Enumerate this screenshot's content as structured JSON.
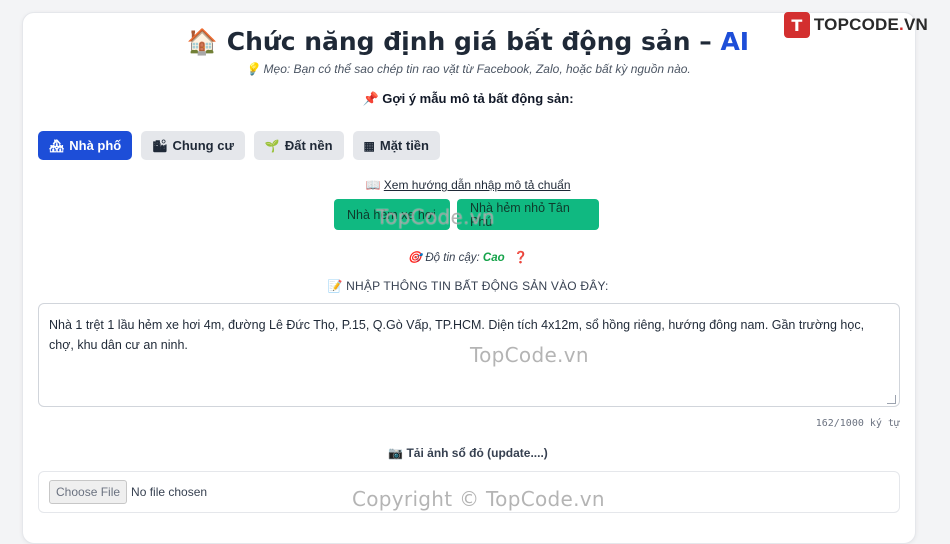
{
  "logo": {
    "mark": "T",
    "text_main": "TOPCODE",
    "text_dot": ".",
    "text_tld": "VN"
  },
  "header": {
    "icon": "🏠",
    "title": "Chức năng định giá bất động sản – ",
    "title_accent": "AI",
    "tip_icon": "💡",
    "tip": "Mẹo: Bạn có thể sao chép tin rao vặt từ Facebook, Zalo, hoặc bất kỳ nguồn nào."
  },
  "suggestions": {
    "icon": "📌",
    "label": "Gợi ý mẫu mô tả bất động sản:",
    "chips": [
      {
        "icon": "🏘",
        "label": "Nhà phố",
        "active": true
      },
      {
        "icon": "🏙",
        "label": "Chung cư",
        "active": false
      },
      {
        "icon": "🌱",
        "label": "Đất nền",
        "active": false
      },
      {
        "icon": "▦",
        "label": "Mặt tiền",
        "active": false
      }
    ]
  },
  "guide": {
    "icon": "📖",
    "link": "Xem hướng dẫn nhập mô tả chuẩn"
  },
  "examples": [
    {
      "label": "Nhà hẻm xe hơi"
    },
    {
      "label": "Nhà hẻm nhỏ Tân Phú"
    }
  ],
  "confidence": {
    "icon": "🎯",
    "label": "Độ tin cậy:",
    "value": "Cao",
    "help": "❓"
  },
  "input": {
    "icon": "📝",
    "title": "NHẬP THÔNG TIN BẤT ĐỘNG SẢN VÀO ĐÂY:",
    "value": "Nhà 1 trệt 1 lầu hẻm xe hơi 4m, đường Lê Đức Thọ, P.15, Q.Gò Vấp, TP.HCM. Diện tích 4x12m, sổ hồng riêng, hướng đông nam. Gần trường học, chợ, khu dân cư an ninh.",
    "counter": "162/1000 ký tự"
  },
  "upload": {
    "icon": "📷",
    "title": "Tải ảnh sổ đỏ (update....)",
    "button": "Choose File",
    "file_name": "No file chosen"
  },
  "watermarks": [
    "TopCode.vn",
    "TopCode.vn",
    "Copyright © TopCode.vn"
  ],
  "colors": {
    "primary": "#1d4ed8",
    "success": "#10b981",
    "confidence": "#16a34a"
  }
}
